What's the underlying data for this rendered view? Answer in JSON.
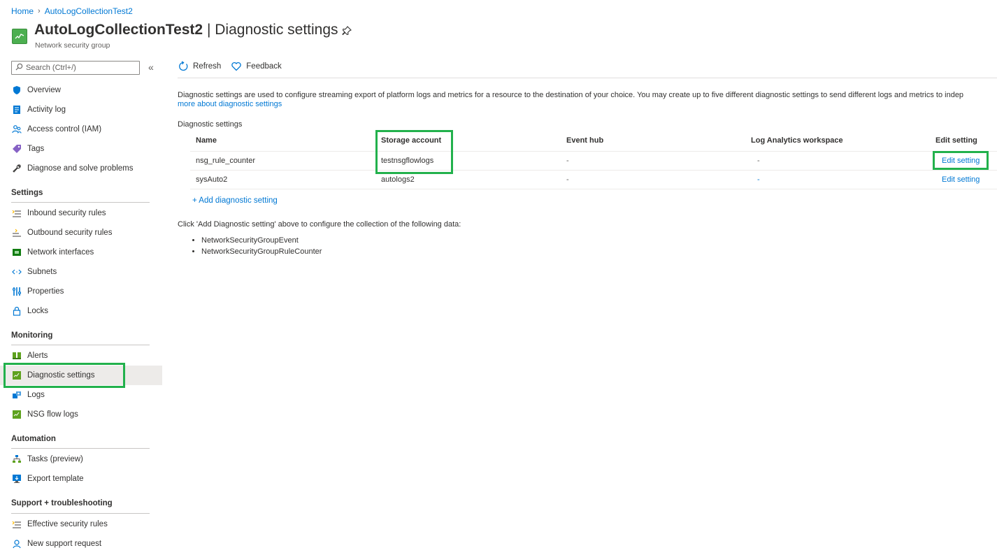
{
  "breadcrumb": {
    "home": "Home",
    "current": "AutoLogCollectionTest2"
  },
  "header": {
    "resource_name": "AutoLogCollectionTest2",
    "separator": "|",
    "page_name": "Diagnostic settings",
    "resource_type": "Network security group",
    "resource_icon": "network-security-group-icon",
    "pin_icon": "pin-icon"
  },
  "sidebar": {
    "search_placeholder": "Search (Ctrl+/)",
    "collapse_label": "«",
    "top_items": [
      {
        "label": "Overview",
        "icon": "shield-icon"
      },
      {
        "label": "Activity log",
        "icon": "activity-log-icon"
      },
      {
        "label": "Access control (IAM)",
        "icon": "people-icon"
      },
      {
        "label": "Tags",
        "icon": "tag-icon"
      },
      {
        "label": "Diagnose and solve problems",
        "icon": "wrench-icon"
      }
    ],
    "sections": [
      {
        "title": "Settings",
        "items": [
          {
            "label": "Inbound security rules",
            "icon": "inbound-rules-icon"
          },
          {
            "label": "Outbound security rules",
            "icon": "outbound-rules-icon"
          },
          {
            "label": "Network interfaces",
            "icon": "network-interface-icon"
          },
          {
            "label": "Subnets",
            "icon": "subnet-icon"
          },
          {
            "label": "Properties",
            "icon": "properties-icon"
          },
          {
            "label": "Locks",
            "icon": "lock-icon"
          }
        ]
      },
      {
        "title": "Monitoring",
        "items": [
          {
            "label": "Alerts",
            "icon": "alerts-icon"
          },
          {
            "label": "Diagnostic settings",
            "icon": "diagnostic-settings-icon",
            "selected": true
          },
          {
            "label": "Logs",
            "icon": "logs-icon"
          },
          {
            "label": "NSG flow logs",
            "icon": "nsg-flow-logs-icon"
          }
        ]
      },
      {
        "title": "Automation",
        "items": [
          {
            "label": "Tasks (preview)",
            "icon": "tasks-icon"
          },
          {
            "label": "Export template",
            "icon": "export-template-icon"
          }
        ]
      },
      {
        "title": "Support + troubleshooting",
        "items": [
          {
            "label": "Effective security rules",
            "icon": "effective-rules-icon"
          },
          {
            "label": "New support request",
            "icon": "support-icon"
          }
        ]
      }
    ]
  },
  "toolbar": {
    "refresh_label": "Refresh",
    "feedback_label": "Feedback"
  },
  "main": {
    "description": "Diagnostic settings are used to configure streaming export of platform logs and metrics for a resource to the destination of your choice. You may create up to five different diagnostic settings to send different logs and metrics to indep",
    "learn_more": "more about diagnostic settings",
    "settings_label": "Diagnostic settings",
    "table": {
      "columns": [
        "Name",
        "Storage account",
        "Event hub",
        "Log Analytics workspace",
        "Edit setting"
      ],
      "rows": [
        {
          "name": "nsg_rule_counter",
          "storage": "testnsgflowlogs",
          "event_hub": "-",
          "workspace": "-",
          "edit": "Edit setting"
        },
        {
          "name": "sysAuto2",
          "storage": "autologs2",
          "event_hub": "-",
          "workspace": "-",
          "edit": "Edit setting"
        }
      ]
    },
    "add_setting": "+ Add diagnostic setting",
    "info_text": "Click 'Add Diagnostic setting' above to configure the collection of the following data:",
    "data_types": [
      "NetworkSecurityGroupEvent",
      "NetworkSecurityGroupRuleCounter"
    ]
  },
  "colors": {
    "link": "#0078d4",
    "highlight": "#22b14c",
    "selected_bg": "#edebe9"
  }
}
